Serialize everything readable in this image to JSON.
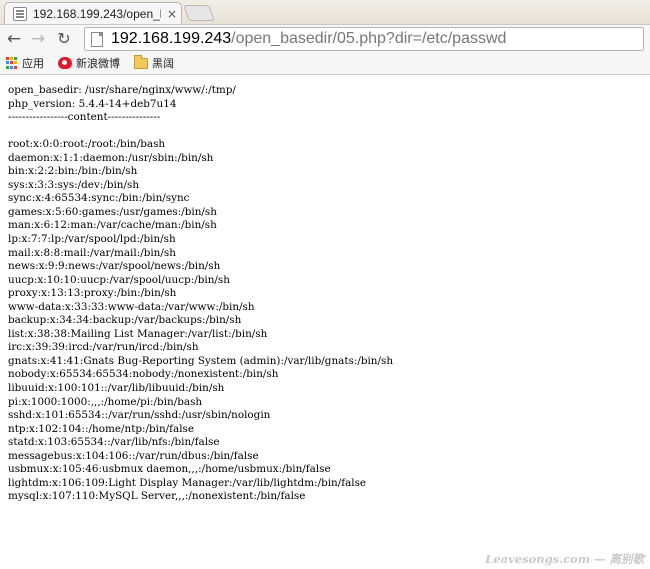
{
  "tab": {
    "title": "192.168.199.243/open_l",
    "close": "×"
  },
  "toolbar": {
    "back": "←",
    "forward": "→",
    "reload": "↻"
  },
  "address": {
    "host": "192.168.199.243",
    "path": "/open_basedir/05.php?dir=/etc/passwd"
  },
  "bookmarks": [
    {
      "label": "应用",
      "icon": "apps-grid-icon"
    },
    {
      "label": "新浪微博",
      "icon": "weibo-icon"
    },
    {
      "label": "黑阔",
      "icon": "folder-icon"
    }
  ],
  "colors": {
    "apps_grid": [
      "#d64535",
      "#f0b400",
      "#2f9d4f",
      "#4a86e8",
      "#d64535",
      "#f0b400",
      "#2f9d4f",
      "#4a86e8",
      "#d64535"
    ],
    "weibo": "#e6162d"
  },
  "page": {
    "header_lines": [
      "open_basedir: /usr/share/nginx/www/:/tmp/",
      "php_version: 5.4.4-14+deb7u14",
      "-----------------content---------------"
    ],
    "passwd_lines": [
      "root:x:0:0:root:/root:/bin/bash",
      "daemon:x:1:1:daemon:/usr/sbin:/bin/sh",
      "bin:x:2:2:bin:/bin:/bin/sh",
      "sys:x:3:3:sys:/dev:/bin/sh",
      "sync:x:4:65534:sync:/bin:/bin/sync",
      "games:x:5:60:games:/usr/games:/bin/sh",
      "man:x:6:12:man:/var/cache/man:/bin/sh",
      "lp:x:7:7:lp:/var/spool/lpd:/bin/sh",
      "mail:x:8:8:mail:/var/mail:/bin/sh",
      "news:x:9:9:news:/var/spool/news:/bin/sh",
      "uucp:x:10:10:uucp:/var/spool/uucp:/bin/sh",
      "proxy:x:13:13:proxy:/bin:/bin/sh",
      "www-data:x:33:33:www-data:/var/www:/bin/sh",
      "backup:x:34:34:backup:/var/backups:/bin/sh",
      "list:x:38:38:Mailing List Manager:/var/list:/bin/sh",
      "irc:x:39:39:ircd:/var/run/ircd:/bin/sh",
      "gnats:x:41:41:Gnats Bug-Reporting System (admin):/var/lib/gnats:/bin/sh",
      "nobody:x:65534:65534:nobody:/nonexistent:/bin/sh",
      "libuuid:x:100:101::/var/lib/libuuid:/bin/sh",
      "pi:x:1000:1000:,,,:/home/pi:/bin/bash",
      "sshd:x:101:65534::/var/run/sshd:/usr/sbin/nologin",
      "ntp:x:102:104::/home/ntp:/bin/false",
      "statd:x:103:65534::/var/lib/nfs:/bin/false",
      "messagebus:x:104:106::/var/run/dbus:/bin/false",
      "usbmux:x:105:46:usbmux daemon,,,:/home/usbmux:/bin/false",
      "lightdm:x:106:109:Light Display Manager:/var/lib/lightdm:/bin/false",
      "mysql:x:107:110:MySQL Server,,,:/nonexistent:/bin/false"
    ]
  },
  "watermark": "Leavesongs.com — 离别歌"
}
